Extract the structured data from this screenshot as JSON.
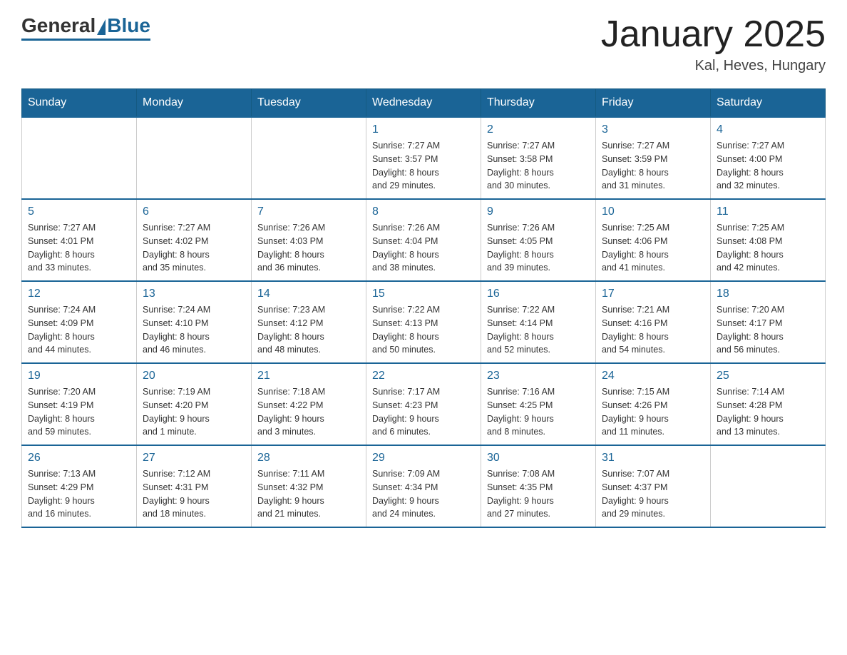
{
  "header": {
    "logo_general": "General",
    "logo_blue": "Blue",
    "title": "January 2025",
    "subtitle": "Kal, Heves, Hungary"
  },
  "days_of_week": [
    "Sunday",
    "Monday",
    "Tuesday",
    "Wednesday",
    "Thursday",
    "Friday",
    "Saturday"
  ],
  "weeks": [
    [
      {
        "day": "",
        "info": ""
      },
      {
        "day": "",
        "info": ""
      },
      {
        "day": "",
        "info": ""
      },
      {
        "day": "1",
        "info": "Sunrise: 7:27 AM\nSunset: 3:57 PM\nDaylight: 8 hours\nand 29 minutes."
      },
      {
        "day": "2",
        "info": "Sunrise: 7:27 AM\nSunset: 3:58 PM\nDaylight: 8 hours\nand 30 minutes."
      },
      {
        "day": "3",
        "info": "Sunrise: 7:27 AM\nSunset: 3:59 PM\nDaylight: 8 hours\nand 31 minutes."
      },
      {
        "day": "4",
        "info": "Sunrise: 7:27 AM\nSunset: 4:00 PM\nDaylight: 8 hours\nand 32 minutes."
      }
    ],
    [
      {
        "day": "5",
        "info": "Sunrise: 7:27 AM\nSunset: 4:01 PM\nDaylight: 8 hours\nand 33 minutes."
      },
      {
        "day": "6",
        "info": "Sunrise: 7:27 AM\nSunset: 4:02 PM\nDaylight: 8 hours\nand 35 minutes."
      },
      {
        "day": "7",
        "info": "Sunrise: 7:26 AM\nSunset: 4:03 PM\nDaylight: 8 hours\nand 36 minutes."
      },
      {
        "day": "8",
        "info": "Sunrise: 7:26 AM\nSunset: 4:04 PM\nDaylight: 8 hours\nand 38 minutes."
      },
      {
        "day": "9",
        "info": "Sunrise: 7:26 AM\nSunset: 4:05 PM\nDaylight: 8 hours\nand 39 minutes."
      },
      {
        "day": "10",
        "info": "Sunrise: 7:25 AM\nSunset: 4:06 PM\nDaylight: 8 hours\nand 41 minutes."
      },
      {
        "day": "11",
        "info": "Sunrise: 7:25 AM\nSunset: 4:08 PM\nDaylight: 8 hours\nand 42 minutes."
      }
    ],
    [
      {
        "day": "12",
        "info": "Sunrise: 7:24 AM\nSunset: 4:09 PM\nDaylight: 8 hours\nand 44 minutes."
      },
      {
        "day": "13",
        "info": "Sunrise: 7:24 AM\nSunset: 4:10 PM\nDaylight: 8 hours\nand 46 minutes."
      },
      {
        "day": "14",
        "info": "Sunrise: 7:23 AM\nSunset: 4:12 PM\nDaylight: 8 hours\nand 48 minutes."
      },
      {
        "day": "15",
        "info": "Sunrise: 7:22 AM\nSunset: 4:13 PM\nDaylight: 8 hours\nand 50 minutes."
      },
      {
        "day": "16",
        "info": "Sunrise: 7:22 AM\nSunset: 4:14 PM\nDaylight: 8 hours\nand 52 minutes."
      },
      {
        "day": "17",
        "info": "Sunrise: 7:21 AM\nSunset: 4:16 PM\nDaylight: 8 hours\nand 54 minutes."
      },
      {
        "day": "18",
        "info": "Sunrise: 7:20 AM\nSunset: 4:17 PM\nDaylight: 8 hours\nand 56 minutes."
      }
    ],
    [
      {
        "day": "19",
        "info": "Sunrise: 7:20 AM\nSunset: 4:19 PM\nDaylight: 8 hours\nand 59 minutes."
      },
      {
        "day": "20",
        "info": "Sunrise: 7:19 AM\nSunset: 4:20 PM\nDaylight: 9 hours\nand 1 minute."
      },
      {
        "day": "21",
        "info": "Sunrise: 7:18 AM\nSunset: 4:22 PM\nDaylight: 9 hours\nand 3 minutes."
      },
      {
        "day": "22",
        "info": "Sunrise: 7:17 AM\nSunset: 4:23 PM\nDaylight: 9 hours\nand 6 minutes."
      },
      {
        "day": "23",
        "info": "Sunrise: 7:16 AM\nSunset: 4:25 PM\nDaylight: 9 hours\nand 8 minutes."
      },
      {
        "day": "24",
        "info": "Sunrise: 7:15 AM\nSunset: 4:26 PM\nDaylight: 9 hours\nand 11 minutes."
      },
      {
        "day": "25",
        "info": "Sunrise: 7:14 AM\nSunset: 4:28 PM\nDaylight: 9 hours\nand 13 minutes."
      }
    ],
    [
      {
        "day": "26",
        "info": "Sunrise: 7:13 AM\nSunset: 4:29 PM\nDaylight: 9 hours\nand 16 minutes."
      },
      {
        "day": "27",
        "info": "Sunrise: 7:12 AM\nSunset: 4:31 PM\nDaylight: 9 hours\nand 18 minutes."
      },
      {
        "day": "28",
        "info": "Sunrise: 7:11 AM\nSunset: 4:32 PM\nDaylight: 9 hours\nand 21 minutes."
      },
      {
        "day": "29",
        "info": "Sunrise: 7:09 AM\nSunset: 4:34 PM\nDaylight: 9 hours\nand 24 minutes."
      },
      {
        "day": "30",
        "info": "Sunrise: 7:08 AM\nSunset: 4:35 PM\nDaylight: 9 hours\nand 27 minutes."
      },
      {
        "day": "31",
        "info": "Sunrise: 7:07 AM\nSunset: 4:37 PM\nDaylight: 9 hours\nand 29 minutes."
      },
      {
        "day": "",
        "info": ""
      }
    ]
  ]
}
